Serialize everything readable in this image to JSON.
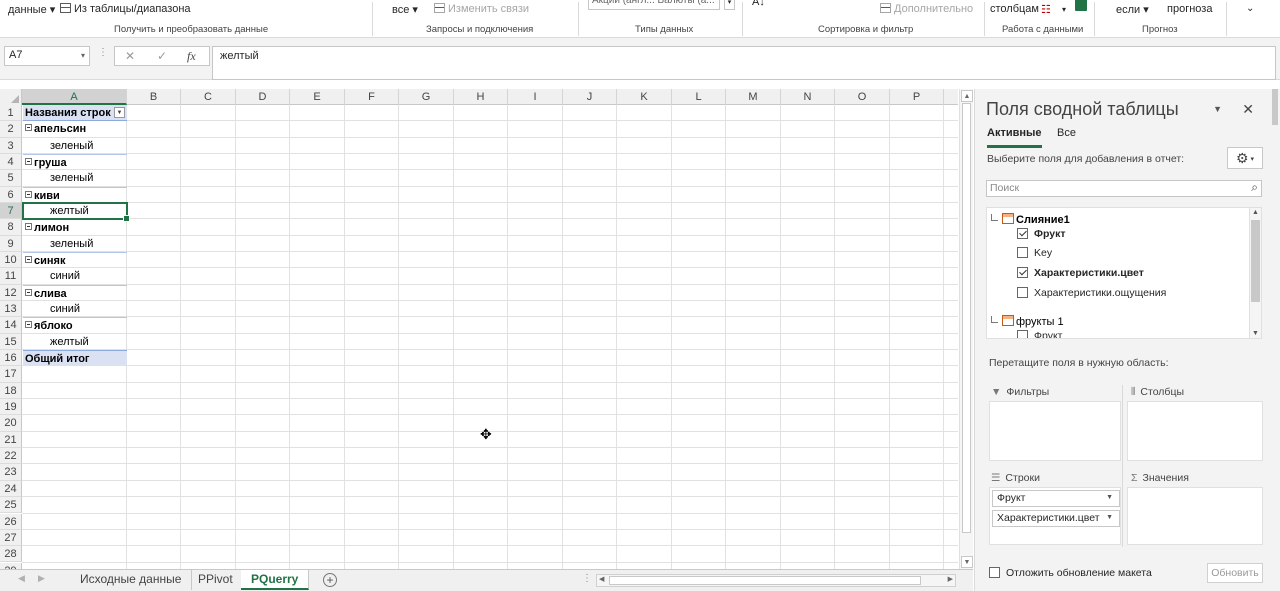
{
  "ribbon": {
    "data_btn": "данные",
    "from_table": "Из таблицы/диапазона",
    "group_get": "Получить и преобразовать данные",
    "refresh_all": "все",
    "edit_links": "Изменить связи",
    "group_queries": "Запросы и подключения",
    "data_types": "Акции (англ...   Валюты (а...",
    "group_types": "Типы данных",
    "advanced": "Дополнительно",
    "group_sort": "Сортировка и фильтр",
    "text_to_cols": "столбцам",
    "group_tools": "Работа с данными",
    "whatif": "если",
    "forecast": "прогноза",
    "group_forecast": "Прогноз"
  },
  "formula_bar": {
    "name_box": "A7",
    "cancel": "✕",
    "enter": "✓",
    "fx": "fx",
    "value": "желтый"
  },
  "grid": {
    "columns": [
      "A",
      "B",
      "C",
      "D",
      "E",
      "F",
      "G",
      "H",
      "I",
      "J",
      "K",
      "L",
      "M",
      "N",
      "O",
      "P"
    ],
    "rows": [
      "1",
      "2",
      "3",
      "4",
      "5",
      "6",
      "7",
      "8",
      "9",
      "10",
      "11",
      "12",
      "13",
      "14",
      "15",
      "16",
      "17",
      "18",
      "19",
      "20",
      "21",
      "22",
      "23",
      "24",
      "25",
      "26",
      "27",
      "28",
      "29"
    ],
    "pivot": {
      "header": "Названия строк",
      "items": [
        {
          "label": "апельсин",
          "child": "зеленый"
        },
        {
          "label": "груша",
          "child": "зеленый"
        },
        {
          "label": "киви",
          "child": "желтый"
        },
        {
          "label": "лимон",
          "child": "зеленый"
        },
        {
          "label": "синяк",
          "child": "синий"
        },
        {
          "label": "слива",
          "child": "синий"
        },
        {
          "label": "яблоко",
          "child": "желтый"
        }
      ],
      "total": "Общий итог"
    },
    "active_cell": "A7"
  },
  "sheets": {
    "tabs": [
      "Исходные данные",
      "PPivot",
      "PQuerry"
    ],
    "active": "PQuerry",
    "add": "+"
  },
  "pivot_panel": {
    "title": "Поля сводной таблицы",
    "tab_active": "Активные",
    "tab_all": "Все",
    "choose_label": "Выберите поля для добавления в отчет:",
    "search_placeholder": "Поиск",
    "tables": [
      {
        "name": "Слияние1",
        "fields": [
          {
            "name": "Фрукт",
            "checked": true
          },
          {
            "name": "Key",
            "checked": false
          },
          {
            "name": "Характеристики.цвет",
            "checked": true
          },
          {
            "name": "Характеристики.ощущения",
            "checked": false
          }
        ]
      },
      {
        "name": "фрукты 1",
        "fields": [
          {
            "name": "Фрукт",
            "checked": false
          }
        ]
      }
    ],
    "drag_label": "Перетащите поля в нужную область:",
    "areas": {
      "filters": "Фильтры",
      "columns": "Столбцы",
      "rows": "Строки",
      "values": "Значения"
    },
    "rows_fields": [
      "Фрукт",
      "Характеристики.цвет"
    ],
    "defer_label": "Отложить обновление макета",
    "update_btn": "Обновить"
  }
}
